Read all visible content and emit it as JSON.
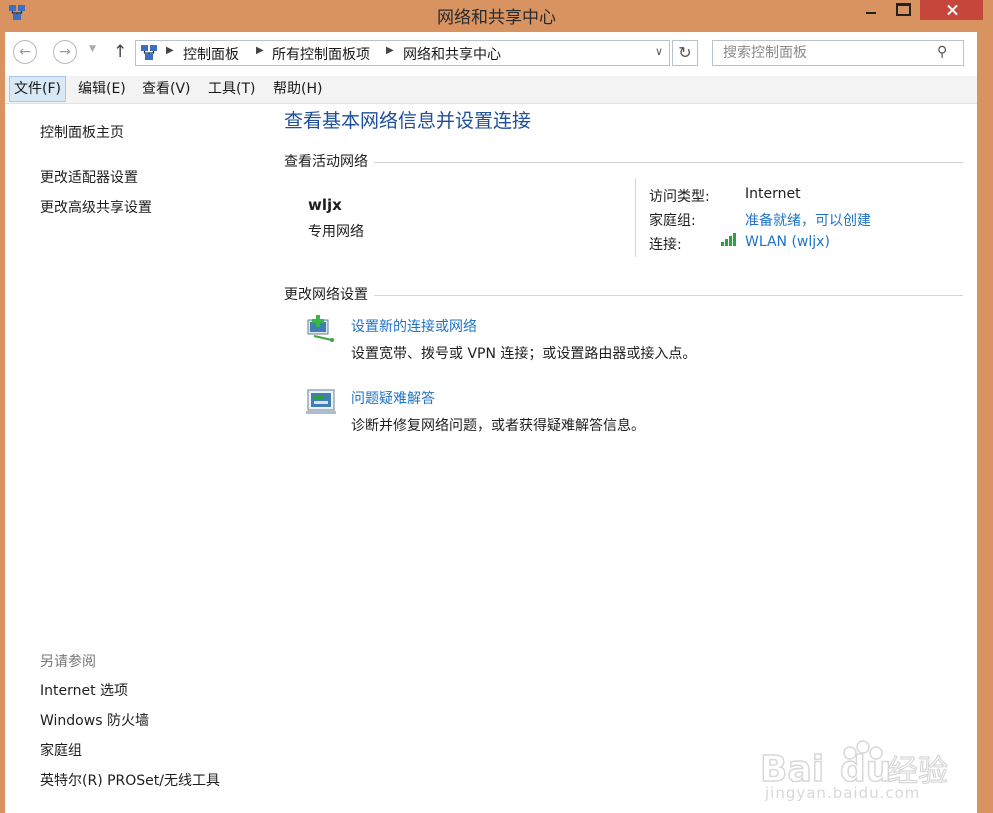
{
  "window": {
    "title": "网络和共享中心",
    "accent": "#d89360",
    "close_color": "#c7463c"
  },
  "navigation": {
    "back_icon": "back-arrow-icon",
    "forward_icon": "forward-arrow-icon",
    "up_icon": "up-arrow-icon",
    "breadcrumbs": [
      "控制面板",
      "所有控制面板项",
      "网络和共享中心"
    ],
    "search_placeholder": "搜索控制面板"
  },
  "menu": {
    "items": [
      "文件(F)",
      "编辑(E)",
      "查看(V)",
      "工具(T)",
      "帮助(H)"
    ],
    "active_index": 0
  },
  "sidebar": {
    "links": [
      "控制面板主页",
      "更改适配器设置",
      "更改高级共享设置"
    ],
    "see_also_title": "另请参阅",
    "see_also": [
      "Internet 选项",
      "Windows 防火墙",
      "家庭组",
      "英特尔(R) PROSet/无线工具"
    ]
  },
  "main": {
    "title": "查看基本网络信息并设置连接",
    "active_networks_header": "查看活动网络",
    "network": {
      "name": "wljx",
      "type": "专用网络",
      "access_type_label": "访问类型:",
      "access_type_value": "Internet",
      "homegroup_label": "家庭组:",
      "homegroup_value": "准备就绪，可以创建",
      "connection_label": "连接:",
      "connection_value": "WLAN (wljx)"
    },
    "change_settings_header": "更改网络设置",
    "tasks": [
      {
        "title": "设置新的连接或网络",
        "description": "设置宽带、拨号或 VPN 连接；或设置路由器或接入点。",
        "icon": "new-connection-icon"
      },
      {
        "title": "问题疑难解答",
        "description": "诊断并修复网络问题，或者获得疑难解答信息。",
        "icon": "troubleshoot-icon"
      }
    ]
  },
  "watermark": {
    "text": "jingyan.baidu.com"
  }
}
